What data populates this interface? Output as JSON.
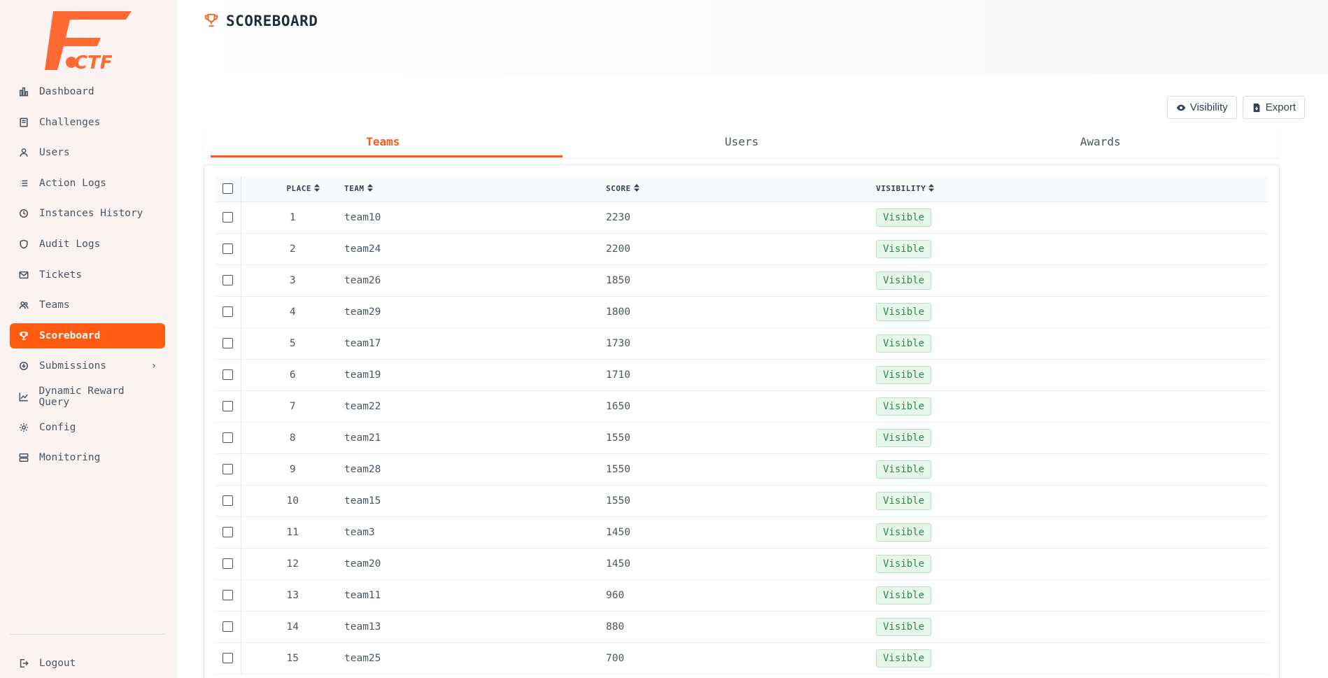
{
  "app": {
    "logo_text": "FCTF"
  },
  "sidebar": {
    "items": [
      {
        "label": "Dashboard",
        "icon": "bar-chart-icon"
      },
      {
        "label": "Challenges",
        "icon": "book-icon"
      },
      {
        "label": "Users",
        "icon": "user-icon"
      },
      {
        "label": "Action Logs",
        "icon": "list-icon"
      },
      {
        "label": "Instances History",
        "icon": "history-icon"
      },
      {
        "label": "Audit Logs",
        "icon": "shield-icon"
      },
      {
        "label": "Tickets",
        "icon": "mail-icon"
      },
      {
        "label": "Teams",
        "icon": "users-icon"
      },
      {
        "label": "Scoreboard",
        "icon": "trophy-icon",
        "active": true
      },
      {
        "label": "Submissions",
        "icon": "submissions-icon",
        "has_children": true
      },
      {
        "label": "Dynamic Reward Query",
        "icon": "line-chart-icon"
      },
      {
        "label": "Config",
        "icon": "gear-icon"
      },
      {
        "label": "Monitoring",
        "icon": "server-icon"
      }
    ],
    "logout_label": "Logout",
    "accent_color": "#ff5a12"
  },
  "header": {
    "title": "SCOREBOARD"
  },
  "actions": {
    "visibility_label": "Visibility",
    "export_label": "Export"
  },
  "tabs": [
    {
      "label": "Teams",
      "active": true
    },
    {
      "label": "Users",
      "active": false
    },
    {
      "label": "Awards",
      "active": false
    }
  ],
  "table": {
    "columns": {
      "place": "PLACE",
      "team": "TEAM",
      "score": "SCORE",
      "visibility": "VISIBILITY"
    },
    "rows": [
      {
        "place": "1",
        "team": "team10",
        "score": "2230",
        "visibility": "Visible"
      },
      {
        "place": "2",
        "team": "team24",
        "score": "2200",
        "visibility": "Visible"
      },
      {
        "place": "3",
        "team": "team26",
        "score": "1850",
        "visibility": "Visible"
      },
      {
        "place": "4",
        "team": "team29",
        "score": "1800",
        "visibility": "Visible"
      },
      {
        "place": "5",
        "team": "team17",
        "score": "1730",
        "visibility": "Visible"
      },
      {
        "place": "6",
        "team": "team19",
        "score": "1710",
        "visibility": "Visible"
      },
      {
        "place": "7",
        "team": "team22",
        "score": "1650",
        "visibility": "Visible"
      },
      {
        "place": "8",
        "team": "team21",
        "score": "1550",
        "visibility": "Visible"
      },
      {
        "place": "9",
        "team": "team28",
        "score": "1550",
        "visibility": "Visible"
      },
      {
        "place": "10",
        "team": "team15",
        "score": "1550",
        "visibility": "Visible"
      },
      {
        "place": "11",
        "team": "team3",
        "score": "1450",
        "visibility": "Visible"
      },
      {
        "place": "12",
        "team": "team20",
        "score": "1450",
        "visibility": "Visible"
      },
      {
        "place": "13",
        "team": "team11",
        "score": "960",
        "visibility": "Visible"
      },
      {
        "place": "14",
        "team": "team13",
        "score": "880",
        "visibility": "Visible"
      },
      {
        "place": "15",
        "team": "team25",
        "score": "700",
        "visibility": "Visible"
      }
    ]
  }
}
